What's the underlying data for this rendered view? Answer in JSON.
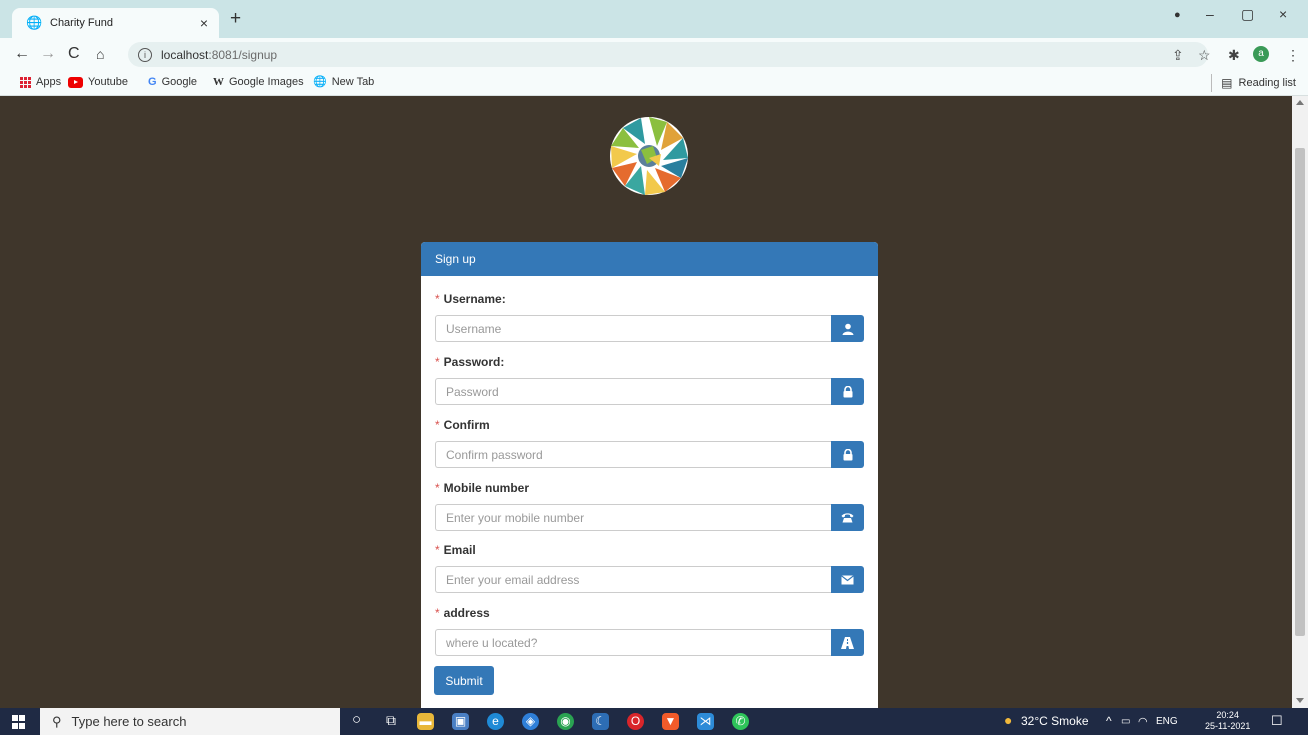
{
  "browser": {
    "tab_title": "Charity Fund",
    "url_host": "localhost",
    "url_path": ":8081/signup",
    "bookmarks": [
      "Apps",
      "Youtube",
      "Google",
      "Google Images",
      "New Tab"
    ],
    "reading_list": "Reading list",
    "profile_initial": "a"
  },
  "form": {
    "header": "Sign up",
    "fields": [
      {
        "label": "Username:",
        "placeholder": "Username",
        "icon": "user-icon"
      },
      {
        "label": "Password:",
        "placeholder": "Password",
        "icon": "lock-icon"
      },
      {
        "label": "Confirm",
        "placeholder": "Confirm password",
        "icon": "lock-icon"
      },
      {
        "label": "Mobile number",
        "placeholder": "Enter your mobile number",
        "icon": "phone-icon"
      },
      {
        "label": "Email",
        "placeholder": "Enter your email address",
        "icon": "envelope-icon"
      },
      {
        "label": "address",
        "placeholder": "where u located?",
        "icon": "road-icon"
      }
    ],
    "submit_label": "Submit",
    "required_mark": "*"
  },
  "taskbar": {
    "search_placeholder": "Type here to search",
    "weather": "32°C Smoke",
    "language": "ENG",
    "time": "20:24",
    "date": "25-11-2021"
  },
  "colors": {
    "page_bg": "#3f362b",
    "primary": "#3478b7",
    "required": "#d9534f"
  }
}
